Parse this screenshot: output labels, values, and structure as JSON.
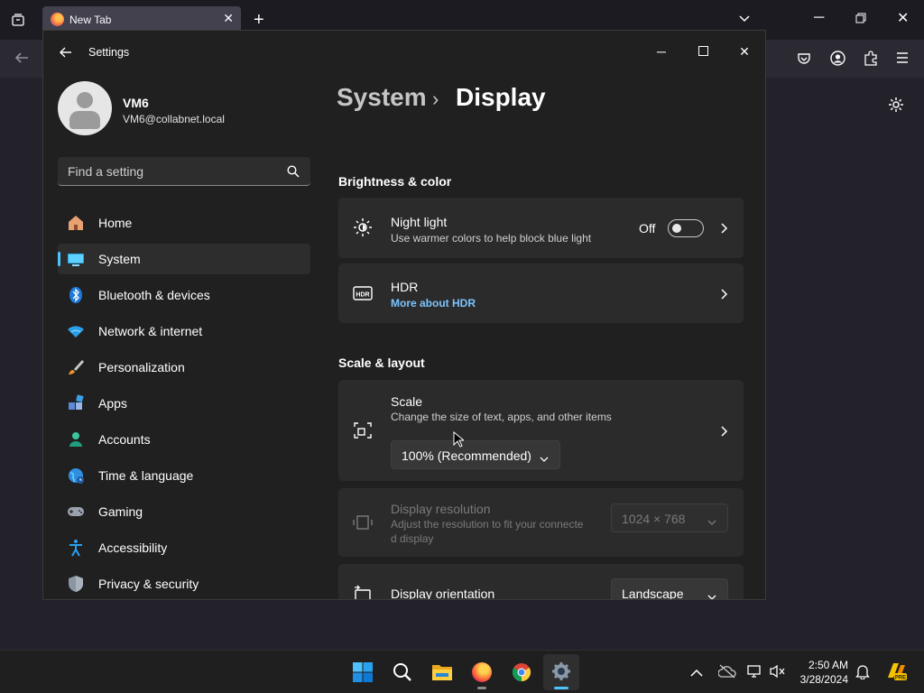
{
  "browser": {
    "tab_title": "New Tab"
  },
  "settings": {
    "window_title": "Settings",
    "user": {
      "name": "VM6",
      "email": "VM6@collabnet.local"
    },
    "search": {
      "placeholder": "Find a setting"
    },
    "nav": [
      {
        "label": "Home",
        "icon": "home-icon"
      },
      {
        "label": "System",
        "icon": "system-icon",
        "selected": true
      },
      {
        "label": "Bluetooth & devices",
        "icon": "bluetooth-icon"
      },
      {
        "label": "Network & internet",
        "icon": "wifi-icon"
      },
      {
        "label": "Personalization",
        "icon": "brush-icon"
      },
      {
        "label": "Apps",
        "icon": "apps-icon"
      },
      {
        "label": "Accounts",
        "icon": "accounts-icon"
      },
      {
        "label": "Time & language",
        "icon": "globe-icon"
      },
      {
        "label": "Gaming",
        "icon": "gamepad-icon"
      },
      {
        "label": "Accessibility",
        "icon": "accessibility-icon"
      },
      {
        "label": "Privacy & security",
        "icon": "shield-icon"
      }
    ],
    "breadcrumb": {
      "parent": "System",
      "separator": "›",
      "current": "Display"
    },
    "brightness": {
      "section_title": "Brightness & color",
      "night_light": {
        "title": "Night light",
        "subtitle": "Use warmer colors to help block blue light",
        "state": "Off"
      },
      "hdr": {
        "title": "HDR",
        "link": "More about HDR"
      }
    },
    "scale_layout": {
      "section_title": "Scale & layout",
      "scale": {
        "title": "Scale",
        "subtitle": "Change the size of text, apps, and other items",
        "value": "100% (Recommended)"
      },
      "resolution": {
        "title": "Display resolution",
        "subtitle_line1": "Adjust the resolution to fit your connecte",
        "subtitle_line2": "d display",
        "value": "1024 × 768"
      },
      "orientation": {
        "title": "Display orientation",
        "value": "Landscape"
      }
    }
  },
  "taskbar": {
    "time": "2:50 AM",
    "date": "3/28/2024"
  },
  "colors": {
    "accent": "#4cc2ff",
    "link": "#7cc4ff",
    "window_bg": "#202020",
    "card_bg": "#2b2b2b"
  }
}
